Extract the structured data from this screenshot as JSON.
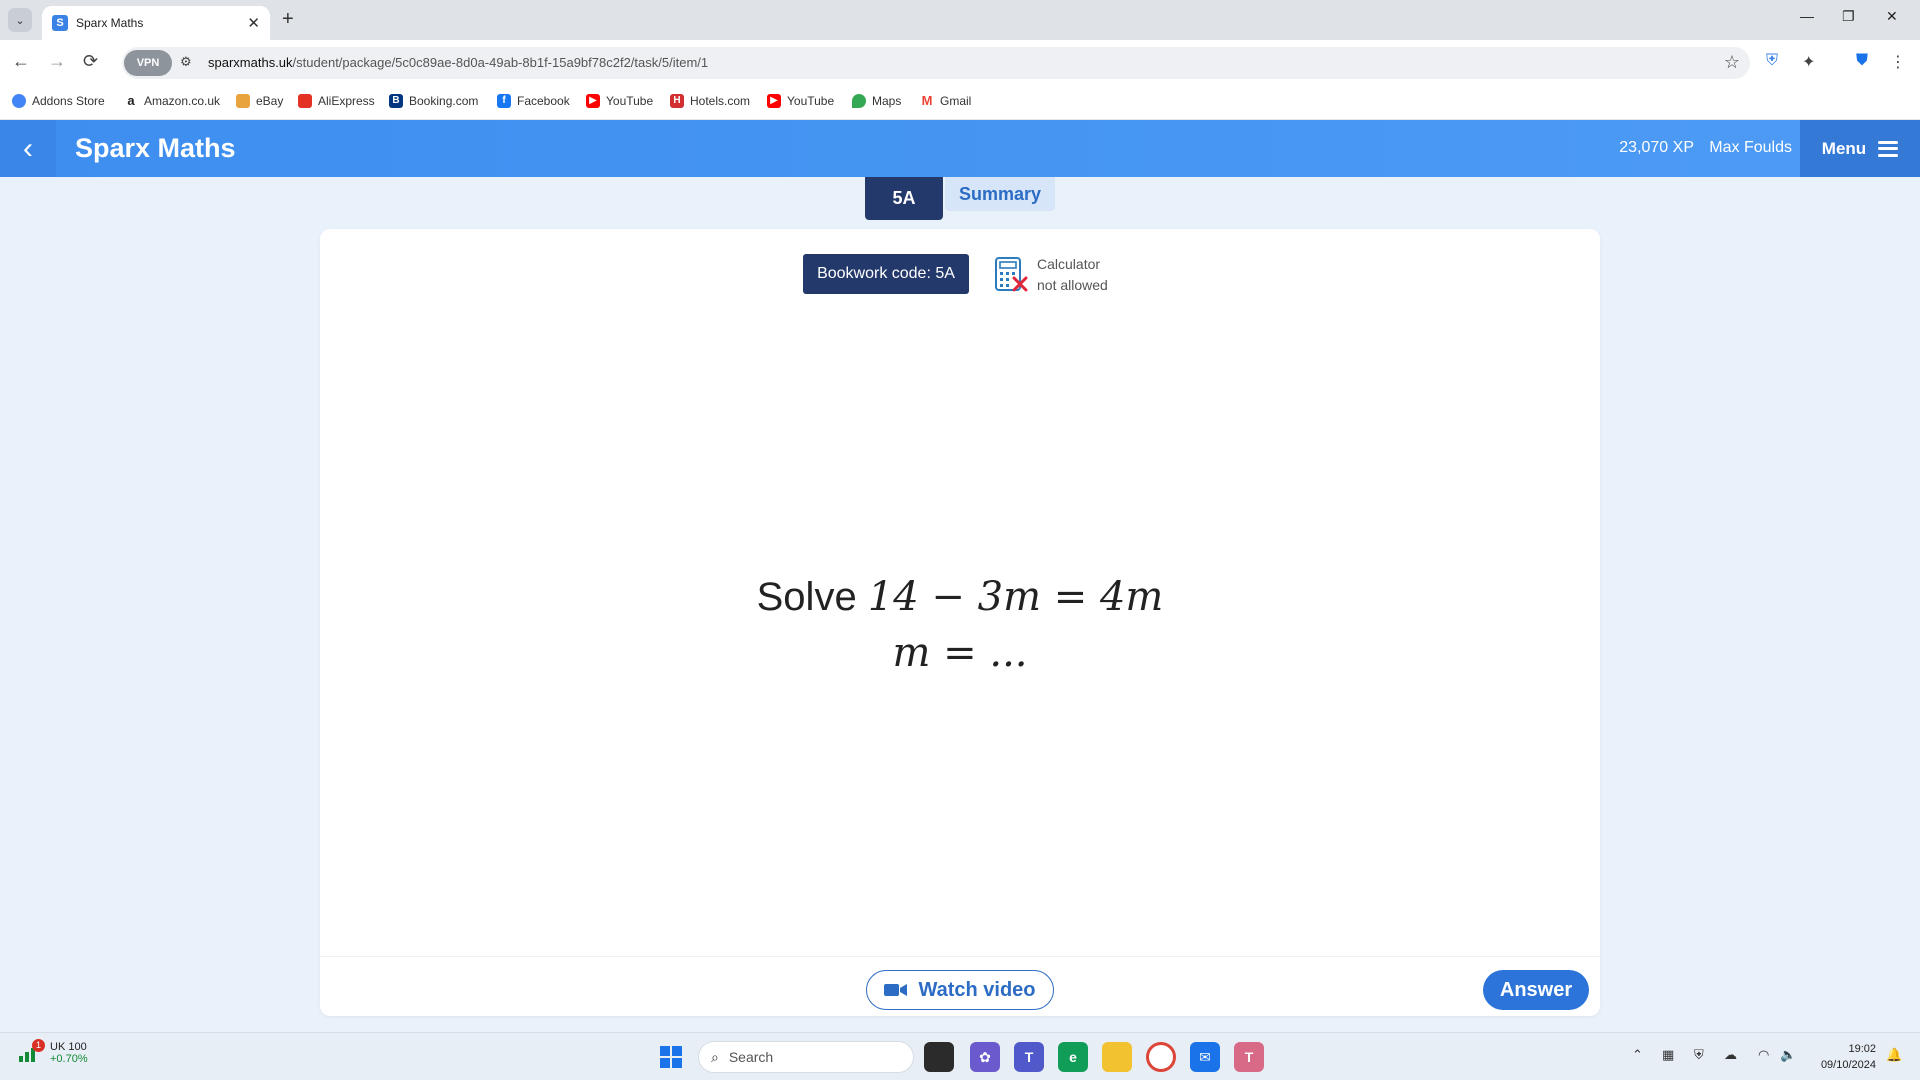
{
  "browser": {
    "tab_title": "Sparx Maths",
    "tab_favicon": "S",
    "new_tab": "+",
    "vpn_label": "VPN",
    "url_domain": "sparxmaths.uk",
    "url_path": "/student/package/5c0c89ae-8d0a-49ab-8b1f-15a9bf78c2f2/task/5/item/1",
    "bookmarks": [
      {
        "label": "Addons Store",
        "icon": "addons-icon",
        "color": "#4285f4"
      },
      {
        "label": "Amazon.co.uk",
        "icon": "amazon-icon",
        "color": "#222222"
      },
      {
        "label": "eBay",
        "icon": "ebay-icon",
        "color": "#e53238"
      },
      {
        "label": "AliExpress",
        "icon": "aliexpress-icon",
        "color": "#e43225"
      },
      {
        "label": "Booking.com",
        "icon": "booking-icon",
        "color": "#003580"
      },
      {
        "label": "Facebook",
        "icon": "facebook-icon",
        "color": "#1877f2"
      },
      {
        "label": "YouTube",
        "icon": "youtube-icon",
        "color": "#ff0000"
      },
      {
        "label": "Hotels.com",
        "icon": "hotels-icon",
        "color": "#d32f2f"
      },
      {
        "label": "YouTube",
        "icon": "youtube-icon",
        "color": "#ff0000"
      },
      {
        "label": "Maps",
        "icon": "maps-icon",
        "color": "#34a853"
      },
      {
        "label": "Gmail",
        "icon": "gmail-icon",
        "color": "#ea4335"
      }
    ]
  },
  "header": {
    "brand": "Sparx Maths",
    "xp": "23,070 XP",
    "user": "Max Foulds",
    "menu": "Menu"
  },
  "tabs": {
    "active": "5A",
    "summary": "Summary"
  },
  "card": {
    "bookwork_code": "Bookwork code: 5A",
    "calculator_line1": "Calculator",
    "calculator_line2": "not allowed",
    "question_word": "Solve",
    "question_equation": "14 − 3m = 4m",
    "answer_prompt": "m = ...",
    "watch_video": "Watch video",
    "answer": "Answer"
  },
  "taskbar": {
    "stock_name": "UK 100",
    "stock_change": "+0.70%",
    "notification_count": "1",
    "search_placeholder": "Search",
    "time": "19:02",
    "date": "09/10/2024"
  },
  "colors": {
    "brand_blue": "#3d8ef0",
    "navy": "#24396b",
    "accent": "#2c74d9"
  }
}
